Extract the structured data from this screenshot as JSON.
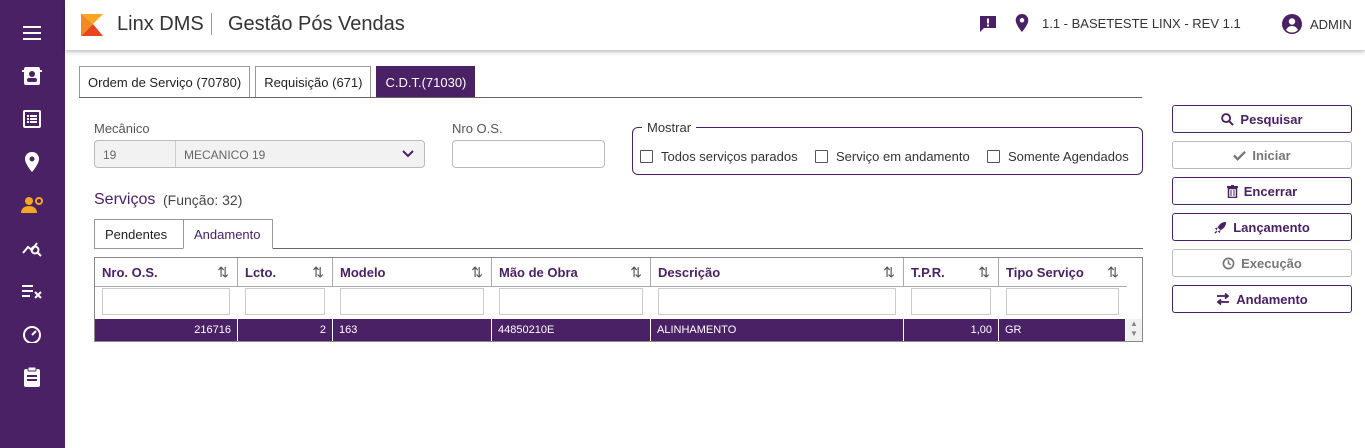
{
  "app": {
    "brand": "Linx DMS",
    "module": "Gestão Pós Vendas",
    "location": "1.1 - BASETESTE LINX - REV 1.1",
    "user": "ADMIN"
  },
  "colors": {
    "primary": "#4a2165",
    "accent": "#f5a623",
    "text": "#333333"
  },
  "sidebar": {
    "icons": [
      "menu-icon",
      "contact-card-icon",
      "list-icon",
      "location-pin-icon",
      "mechanic-icon",
      "analytics-icon",
      "checklist-icon",
      "speedometer-icon",
      "clipboard-icon"
    ]
  },
  "tabs": [
    {
      "label": "Ordem de Serviço (70780)"
    },
    {
      "label": "Requisição (671)"
    },
    {
      "label": "C.D.T.(71030)"
    }
  ],
  "filters": {
    "mecanico_label": "Mecânico",
    "mecanico_code": "19",
    "mecanico_name": "MECANICO 19",
    "nro_os_label": "Nro O.S.",
    "nro_os_value": "",
    "mostrar_label": "Mostrar",
    "checkboxes": [
      "Todos serviços parados",
      "Serviço em andamento",
      "Somente Agendados"
    ]
  },
  "servicos": {
    "title": "Serviços",
    "subtitle": "(Função: 32)",
    "subtabs": [
      "Pendentes",
      "Andamento"
    ]
  },
  "grid": {
    "columns": [
      "Nro. O.S.",
      "Lcto.",
      "Modelo",
      "Mão de Obra",
      "Descrição",
      "T.P.R.",
      "Tipo Serviço"
    ],
    "rows": [
      [
        "216716",
        "2",
        "163",
        "44850210E",
        "ALINHAMENTO",
        "1,00",
        "GR"
      ]
    ]
  },
  "actions": [
    "Pesquisar",
    "Iniciar",
    "Encerrar",
    "Lançamento",
    "Execução",
    "Andamento"
  ]
}
